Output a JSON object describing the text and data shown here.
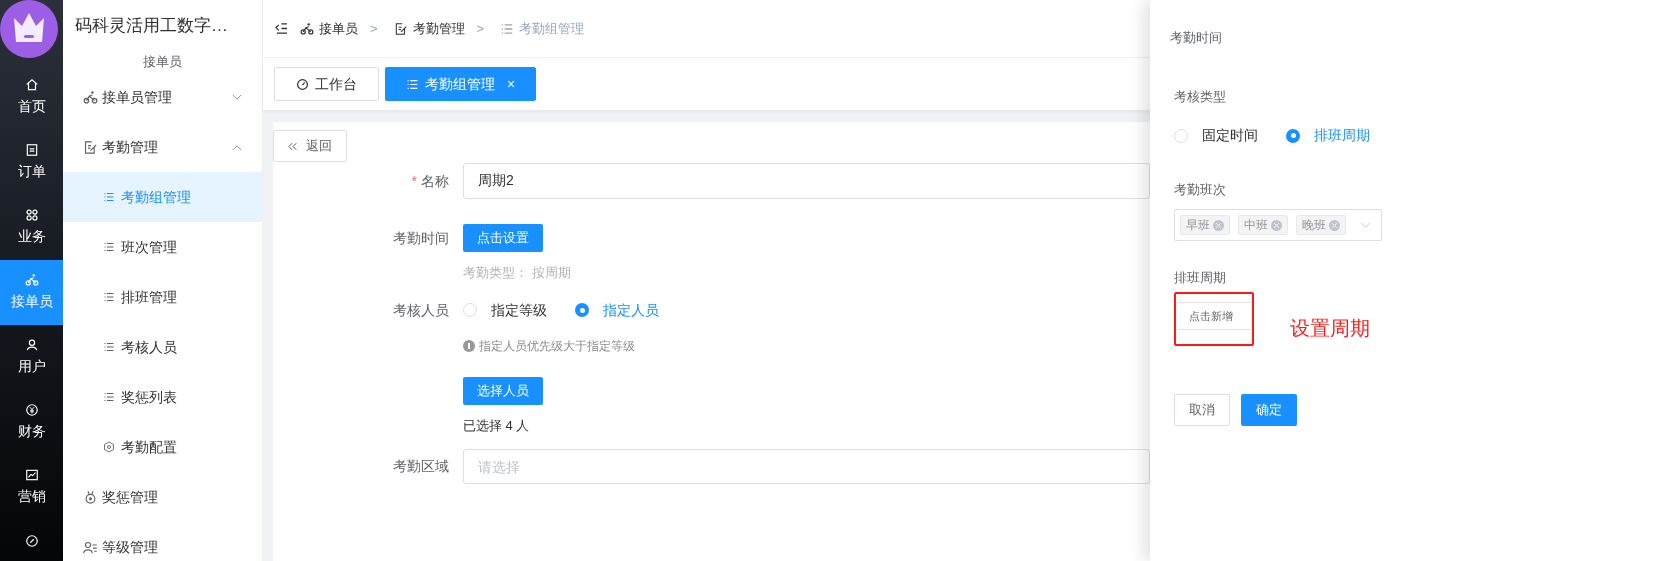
{
  "rail": {
    "items": [
      {
        "label": "首页",
        "kind": "home",
        "selected": false
      },
      {
        "label": "订单",
        "kind": "order",
        "selected": false
      },
      {
        "label": "业务",
        "kind": "grid",
        "selected": false
      },
      {
        "label": "接单员",
        "kind": "cyclist",
        "selected": true
      },
      {
        "label": "用户",
        "kind": "user",
        "selected": false
      },
      {
        "label": "财务",
        "kind": "money",
        "selected": false
      },
      {
        "label": "营销",
        "kind": "chart",
        "selected": false
      },
      {
        "kind": "link",
        "selected": false
      }
    ]
  },
  "sidebar": {
    "title": "码科灵活用工数字…",
    "section": "接单员",
    "items": [
      {
        "label": "接单员管理",
        "kind": "cyclist",
        "expanded": false
      },
      {
        "label": "考勤管理",
        "kind": "edit",
        "expanded": true,
        "children": [
          {
            "label": "考勤组管理",
            "kind": "list",
            "selected": true
          },
          {
            "label": "班次管理",
            "kind": "list",
            "selected": false
          },
          {
            "label": "排班管理",
            "kind": "list",
            "selected": false
          },
          {
            "label": "考核人员",
            "kind": "list",
            "selected": false
          },
          {
            "label": "奖惩列表",
            "kind": "list",
            "selected": false
          },
          {
            "label": "考勤配置",
            "kind": "hex",
            "selected": false
          }
        ]
      },
      {
        "label": "奖惩管理",
        "kind": "medal"
      },
      {
        "label": "等级管理",
        "kind": "users"
      }
    ]
  },
  "breadcrumb": {
    "separator": ">",
    "items": [
      {
        "label": "接单员",
        "kind": "cyclist"
      },
      {
        "label": "考勤管理",
        "kind": "edit"
      },
      {
        "label": "考勤组管理",
        "kind": "list"
      }
    ]
  },
  "tabs": [
    {
      "label": "工作台",
      "kind": "gauge",
      "selected": false
    },
    {
      "label": "考勤组管理",
      "kind": "list",
      "selected": true,
      "close": "×"
    }
  ],
  "back_button": "返回",
  "form": {
    "required_mark": "*",
    "rows": [
      {
        "kind": "input",
        "label": "名称",
        "required": true,
        "value": "周期2"
      },
      {
        "kind": "button",
        "label": "考勤时间",
        "required": false,
        "button": "点击设置",
        "note": "考勤类型： 按周期"
      },
      {
        "kind": "radio",
        "label": "考核人员",
        "required": false,
        "options": [
          {
            "label": "指定等级",
            "selected": false
          },
          {
            "label": "指定人员",
            "selected": true
          }
        ],
        "hint": "指定人员优先级大于指定等级",
        "button": "选择人员",
        "note": "已选择 4 人"
      },
      {
        "kind": "select",
        "label": "考勤区域",
        "required": false,
        "placeholder": "请选择"
      }
    ]
  },
  "drawer": {
    "title": "考勤时间",
    "type_label": "考核类型",
    "type_options": [
      {
        "label": "固定时间",
        "selected": false
      },
      {
        "label": "排班周期",
        "selected": true
      }
    ],
    "shift_label": "考勤班次",
    "shifts": [
      "早班",
      "中班",
      "晚班"
    ],
    "cycle_label": "排班周期",
    "cycle_add": "点击新增",
    "cancel": "取消",
    "confirm": "确定"
  },
  "annotation": {
    "text": "设置周期"
  }
}
